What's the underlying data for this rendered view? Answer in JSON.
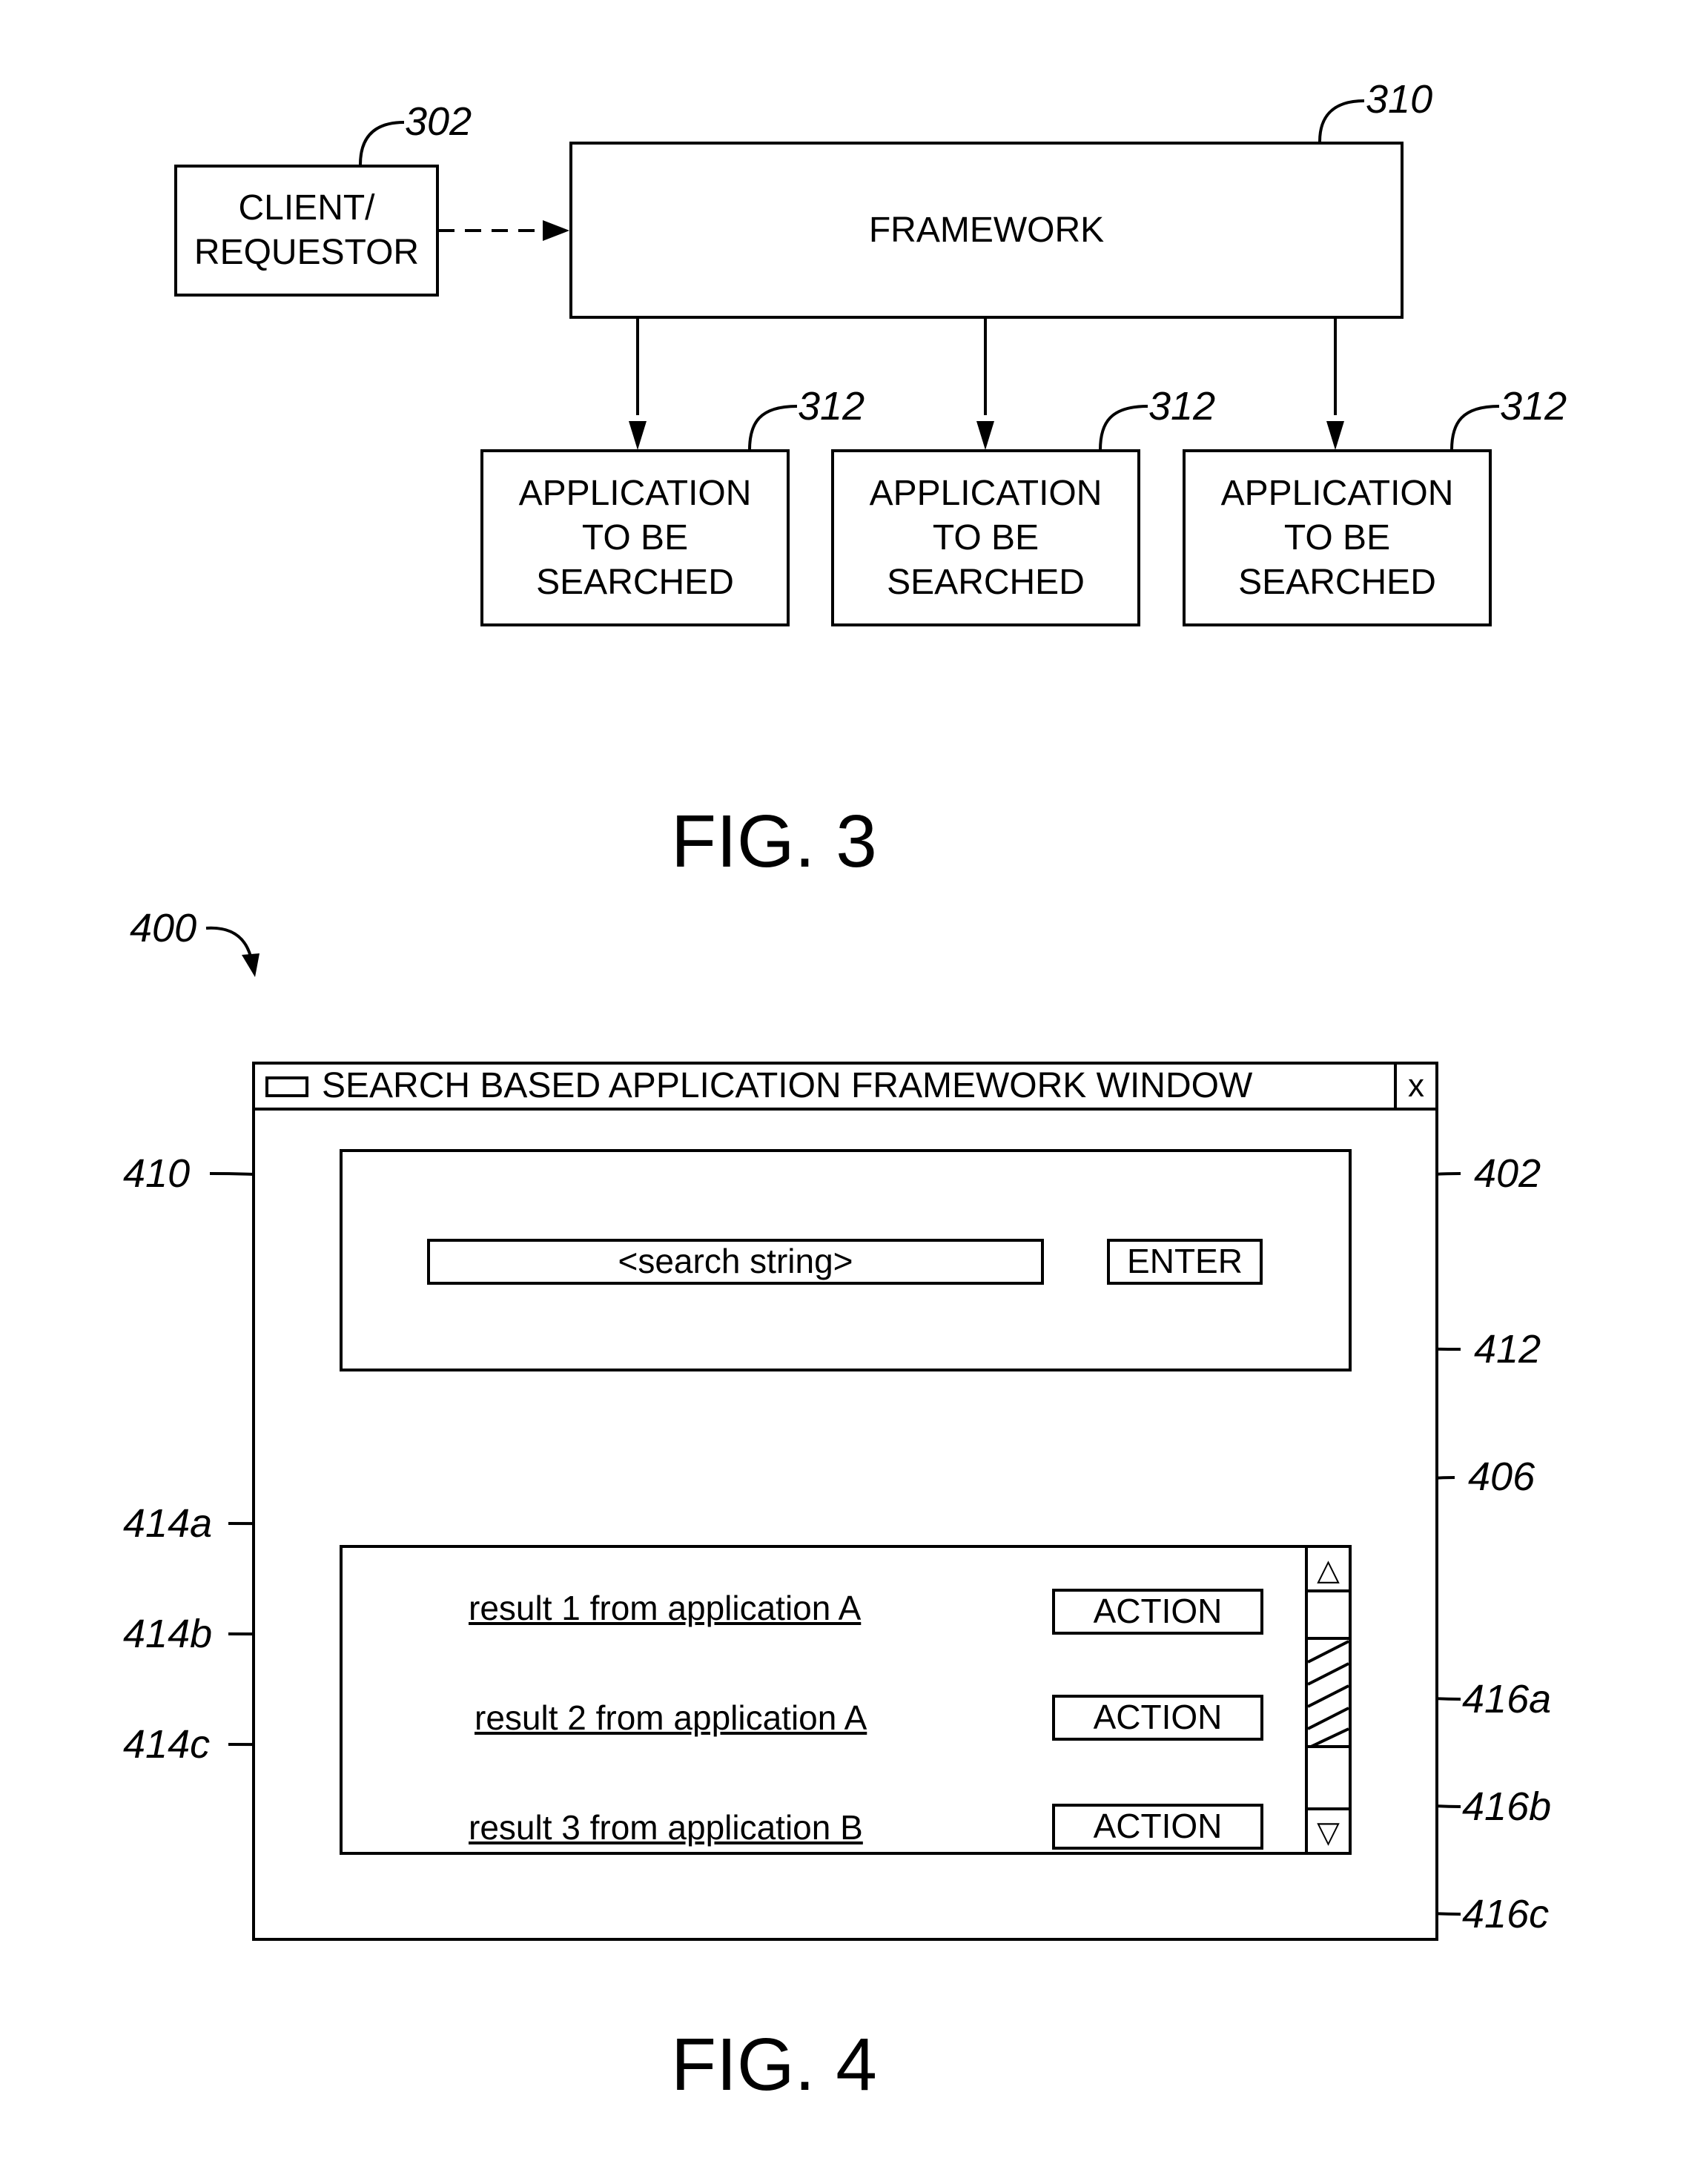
{
  "fig3": {
    "caption": "FIG. 3",
    "client": {
      "ref": "302",
      "line1": "CLIENT/",
      "line2": "REQUESTOR"
    },
    "framework": {
      "ref": "310",
      "label": "FRAMEWORK"
    },
    "applications": [
      {
        "ref": "312",
        "line1": "APPLICATION",
        "line2": "TO BE",
        "line3": "SEARCHED"
      },
      {
        "ref": "312",
        "line1": "APPLICATION",
        "line2": "TO BE",
        "line3": "SEARCHED"
      },
      {
        "ref": "312",
        "line1": "APPLICATION",
        "line2": "TO BE",
        "line3": "SEARCHED"
      }
    ]
  },
  "fig4": {
    "caption": "FIG. 4",
    "ref": "400",
    "window": {
      "title": "SEARCH BASED APPLICATION FRAMEWORK WINDOW",
      "close_label": "x"
    },
    "search_panel": {
      "ref": "402",
      "input": {
        "ref": "410",
        "value": "<search string>"
      },
      "enter_button": {
        "ref": "412",
        "label": "ENTER"
      }
    },
    "results_panel": {
      "scrollbar_ref": "406",
      "scroll_up_glyph": "△",
      "scroll_down_glyph": "▽",
      "results": [
        {
          "ref": "414a",
          "text": "result 1 from application A",
          "action_ref": "416a",
          "action_label": "ACTION"
        },
        {
          "ref": "414b",
          "text": "result 2 from application A",
          "action_ref": "416b",
          "action_label": "ACTION"
        },
        {
          "ref": "414c",
          "text": "result 3 from application B",
          "action_ref": "416c",
          "action_label": "ACTION"
        }
      ]
    }
  }
}
